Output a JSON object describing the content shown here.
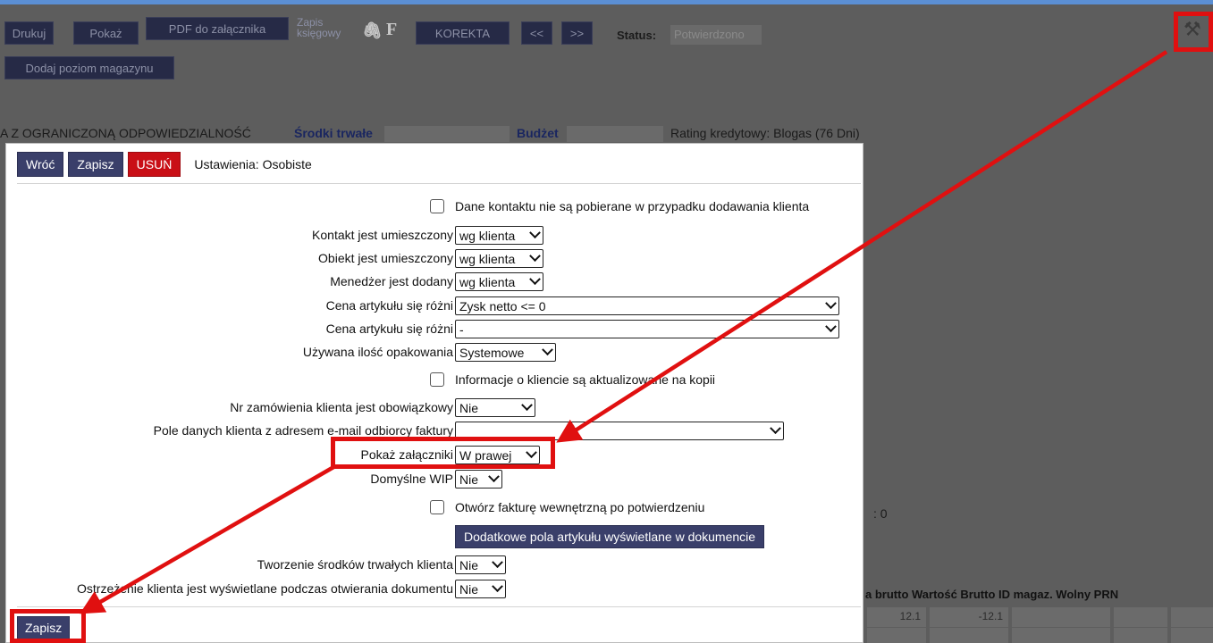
{
  "toolbar": {
    "print": "Drukuj",
    "show": "Pokaż",
    "pdf_attach": "PDF do załącznika",
    "journal_line1": "Zapis",
    "journal_line2": "księgowy",
    "f_label": "F",
    "correction": "KOREKTA",
    "prev": "<<",
    "next": ">>",
    "status_label": "Status:",
    "status_value": "Potwierdzono",
    "add_stock_level": "Dodaj poziom magazynu"
  },
  "background": {
    "company": "A Z OGRANICZONĄ ODPOWIEDZIALNOŚĆ",
    "fixed_assets": "Środki trwałe",
    "budget": "Budżet",
    "rating": "Rating kredytowy: Blogas (76 Dni)",
    "partial_zero": ": 0",
    "table_headers": "a brutto Wartość Brutto ID magaz.   Wolny    PRN",
    "cell_1": "12.1",
    "cell_2": "-12.1"
  },
  "modal": {
    "back": "Wróć",
    "save": "Zapisz",
    "delete": "USUŃ",
    "title": "Ustawienia: Osobiste",
    "rows": {
      "contact_data": "Dane kontaktu nie są pobierane w przypadku dodawania klienta",
      "contact_placed": {
        "label": "Kontakt jest umieszczony",
        "value": "wg klienta"
      },
      "object_placed": {
        "label": "Obiekt jest umieszczony",
        "value": "wg klienta"
      },
      "manager_added": {
        "label": "Menedżer jest dodany",
        "value": "wg klienta"
      },
      "price_diff_1": {
        "label": "Cena artykułu się różni",
        "value": "Zysk netto <= 0"
      },
      "price_diff_2": {
        "label": "Cena artykułu się różni",
        "value": "-"
      },
      "pack_qty": {
        "label": "Używana ilość opakowania",
        "value": "Systemowe"
      },
      "client_info_copy": "Informacje o kliencie są aktualizowane na kopii",
      "order_nr_required": {
        "label": "Nr zamówienia klienta jest obowiązkowy",
        "value": "Nie"
      },
      "invoice_email_field": {
        "label": "Pole danych klienta z adresem e-mail odbiorcy faktury",
        "value": ""
      },
      "show_attachments": {
        "label": "Pokaż załączniki",
        "value": "W prawej"
      },
      "default_wip": {
        "label": "Domyślne WIP",
        "value": "Nie"
      },
      "open_internal_invoice": "Otwórz fakturę wewnętrzną po potwierdzeniu",
      "extra_fields_button": "Dodatkowe pola artykułu wyświetlane w dokumencie",
      "fixed_assets_creation": {
        "label": "Tworzenie środków trwałych klienta",
        "value": "Nie"
      },
      "client_warning": {
        "label": "Ostrzeżenie klienta jest wyświetlane podczas otwierania dokumentu",
        "value": "Nie"
      }
    },
    "save_bottom": "Zapisz"
  },
  "colors": {
    "accent": "#3a3f6a",
    "danger": "#c90f16",
    "annotation": "#e01010"
  }
}
